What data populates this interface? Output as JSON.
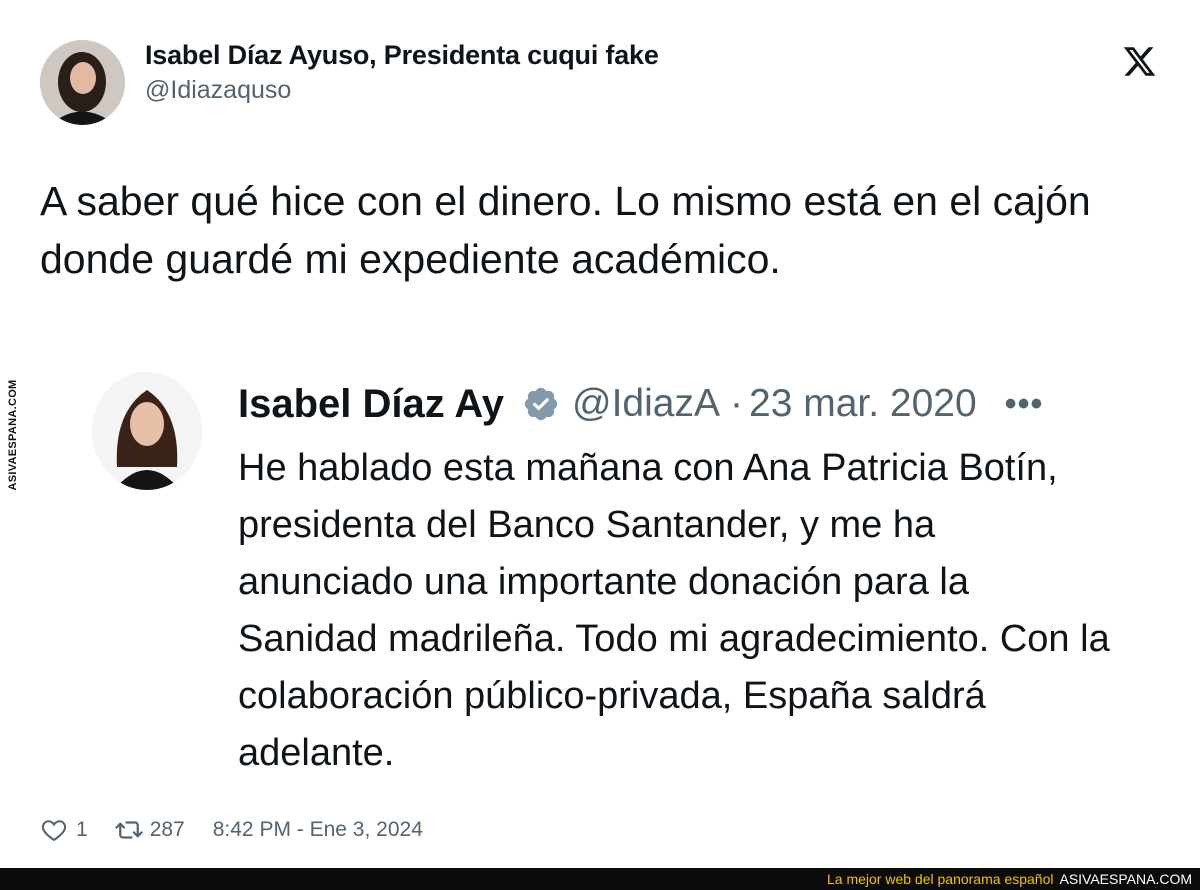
{
  "tweet": {
    "author_name": "Isabel Díaz Ayuso, Presidenta cuqui fake",
    "author_handle": "@Idiazaquso",
    "text": "A saber qué hice con el dinero. Lo mismo está en el cajón donde guardé mi expediente académico.",
    "likes": "1",
    "retweets": "287",
    "timestamp": "8:42 PM - Ene 3, 2024"
  },
  "quoted": {
    "author_name": "Isabel Díaz Ay",
    "author_handle": "@IdiazA",
    "separator": "·",
    "date": "23 mar. 2020",
    "more": "•••",
    "text": "He hablado esta mañana con Ana Patricia Botín, presidenta del Banco Santander, y me ha anunciado una importante donación para la Sanidad madrileña. Todo mi agradecimiento. Con la colaboración público-privada, España saldrá adelante."
  },
  "watermark": {
    "side_text": "ASIVAESPANA.COM",
    "banner_slogan": "La mejor web del panorama español",
    "banner_brand": "ASIVAESPANA.COM"
  },
  "icons": {
    "brand": "x-logo-icon",
    "verified": "verified-badge-icon",
    "like": "heart-icon",
    "retweet": "retweet-icon"
  },
  "colors": {
    "text": "#0f1419",
    "secondary": "#536471",
    "verified": "#829aab",
    "banner_bg": "#0b0b0b",
    "banner_text": "#f5c400"
  }
}
